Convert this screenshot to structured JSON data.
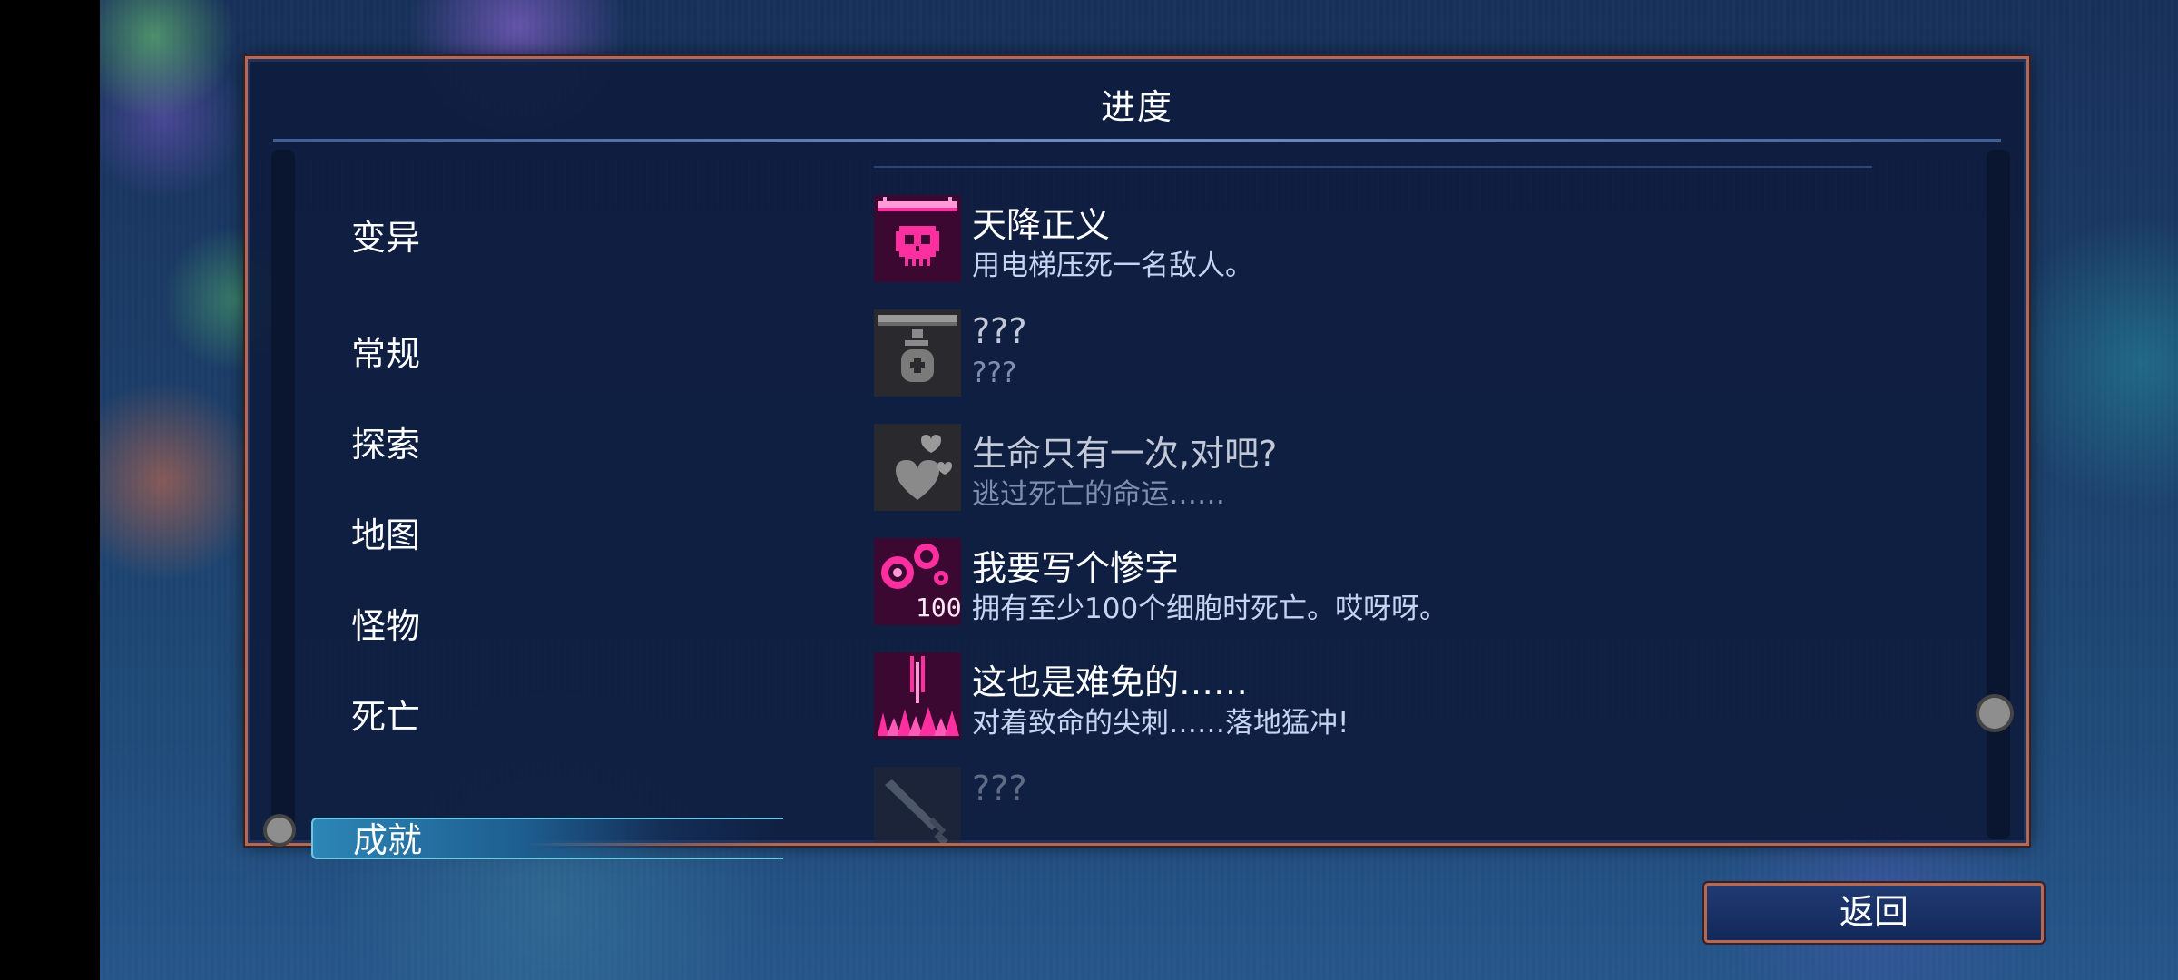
{
  "panel": {
    "title": "进度"
  },
  "categories": [
    {
      "label": "变异",
      "selected": false
    },
    {
      "label": "常规",
      "selected": false
    },
    {
      "label": "探索",
      "selected": false
    },
    {
      "label": "地图",
      "selected": false
    },
    {
      "label": "怪物",
      "selected": false
    },
    {
      "label": "死亡",
      "selected": false
    },
    {
      "label": "成就",
      "selected": true
    }
  ],
  "achievements": [
    {
      "title": "天降正义",
      "description": "用电梯压死一名敌人。",
      "unlocked": true,
      "icon": "skull-elevator-icon"
    },
    {
      "title": "???",
      "description": "???",
      "unlocked": false,
      "icon": "elevator-grenade-icon"
    },
    {
      "title": "生命只有一次,对吧?",
      "description": "逃过死亡的命运……",
      "unlocked": false,
      "icon": "hearts-icon"
    },
    {
      "title": "我要写个惨字",
      "description": "拥有至少100个细胞时死亡。哎呀呀。",
      "unlocked": true,
      "icon": "cells-100-icon",
      "icon_text": "100"
    },
    {
      "title": "这也是难免的……",
      "description": "对着致命的尖刺……落地猛冲!",
      "unlocked": true,
      "icon": "spikes-icon"
    },
    {
      "title": "???",
      "description": "",
      "unlocked": false,
      "icon": "sword-icon"
    }
  ],
  "buttons": {
    "back": "返回"
  },
  "colors": {
    "frame_border": "#b26a54",
    "panel_bg": "#0e1c3e",
    "selected_highlight": "#2c86b6",
    "achievement_pink": "#ff2fa0"
  }
}
